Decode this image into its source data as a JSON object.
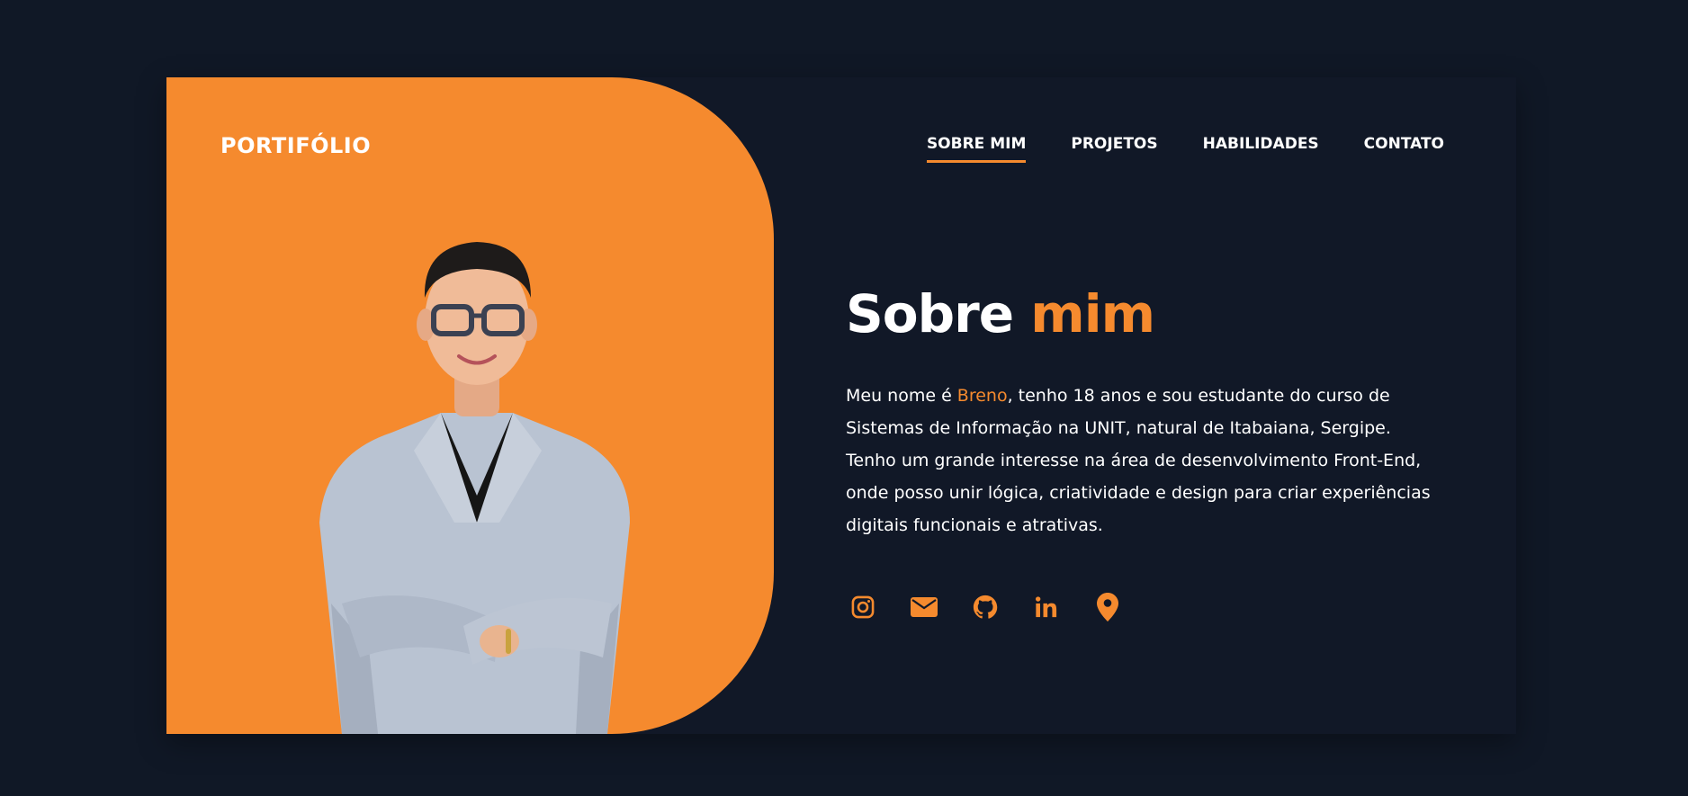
{
  "brand": {
    "logo": "PORTIFÓLIO",
    "accent_color": "#f58a2e",
    "background_color": "#111827"
  },
  "nav": {
    "items": [
      {
        "label": "SOBRE MIM",
        "active": true
      },
      {
        "label": "PROJETOS",
        "active": false
      },
      {
        "label": "HABILIDADES",
        "active": false
      },
      {
        "label": "CONTATO",
        "active": false
      }
    ]
  },
  "about": {
    "title_main": "Sobre",
    "title_accent": "mim",
    "bio_prefix": "Meu nome é ",
    "bio_name": "Breno",
    "bio_suffix": ", tenho 18 anos e sou estudante do curso de Sistemas de Informação na UNIT, natural de Itabaiana, Sergipe. Tenho um grande interesse na área de desenvolvimento Front-End, onde posso unir lógica, criatividade e design para criar experiências digitais funcionais e atrativas."
  },
  "socials": [
    {
      "icon": "instagram-icon"
    },
    {
      "icon": "email-icon"
    },
    {
      "icon": "github-icon"
    },
    {
      "icon": "linkedin-icon"
    },
    {
      "icon": "location-pin-icon"
    }
  ],
  "photo": {
    "icon": "profile-photo"
  }
}
